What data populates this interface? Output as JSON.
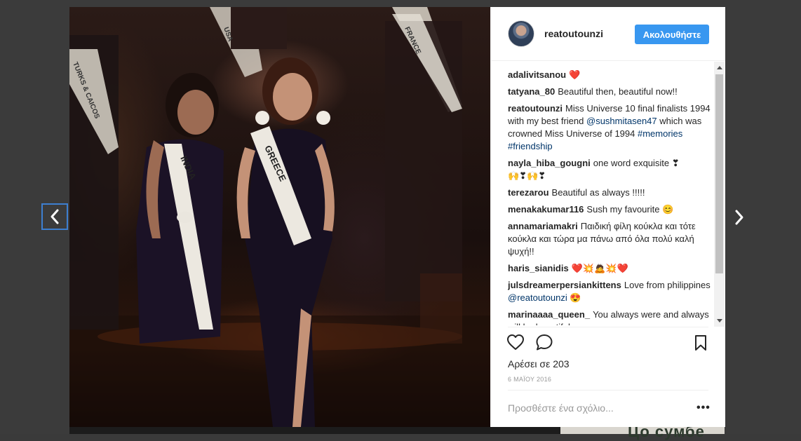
{
  "post": {
    "username": "reatoutounzi",
    "follow_label": "Ακολουθήστε",
    "likes_text": "Αρέσει σε 203",
    "date": "6 ΜΑΪΟΥ 2016",
    "add_comment_placeholder": "Προσθέστε ένα σχόλιο...",
    "more_label": "•••"
  },
  "photo": {
    "sash_labels": [
      "INDIA",
      "GREECE"
    ],
    "background_sash_labels": [
      "TURKS & CAICOS",
      "USA",
      "FRANCE"
    ]
  },
  "comments": [
    {
      "user": "adalivitsanou",
      "text": "",
      "emoji": "❤️"
    },
    {
      "user": "tatyana_80",
      "text": "Beautiful then, beautiful now!!",
      "emoji": ""
    },
    {
      "user": "reatoutounzi",
      "text": "Miss Universe 10 final finalists 1994 with my best friend",
      "mention": "@sushmitasen47",
      "text2": "which was crowned Miss Universe of 1994",
      "tag1": "#memories",
      "tag2": "#friendship"
    },
    {
      "user": "nayla_hiba_gougni",
      "text": "one word exquisite ❣",
      "emoji": "🙌❣🙌❣"
    },
    {
      "user": "terezarou",
      "text": "Beautiful as always !!!!!",
      "emoji": ""
    },
    {
      "user": "menakakumar116",
      "text": "Sush my favourite",
      "emoji": "😊"
    },
    {
      "user": "annamariamakri",
      "text": "Παιδική φίλη κούκλα και τότε κούκλα και τώρα μα πάνω από όλα πολύ καλή ψυχή!!",
      "emoji": ""
    },
    {
      "user": "haris_sianidis",
      "text": "",
      "emoji": "❤️💥🙇💥❤️"
    },
    {
      "user": "julsdreamerpersiankittens",
      "text": "Love from philippines",
      "mention": "@reatoutounzi",
      "emoji": "😍"
    },
    {
      "user": "marinaaaa_queen_",
      "text": "You always were and always will be beautiful ...",
      "emoji": ""
    }
  ],
  "icons": {
    "like": "heart-icon",
    "comment": "comment-icon",
    "save": "bookmark-icon",
    "prev": "chevron-left-icon",
    "next": "chevron-right-icon",
    "more": "more-icon"
  },
  "colors": {
    "follow_button": "#3897f0",
    "link": "#003569",
    "nav_focus": "#3d7fd0"
  }
}
